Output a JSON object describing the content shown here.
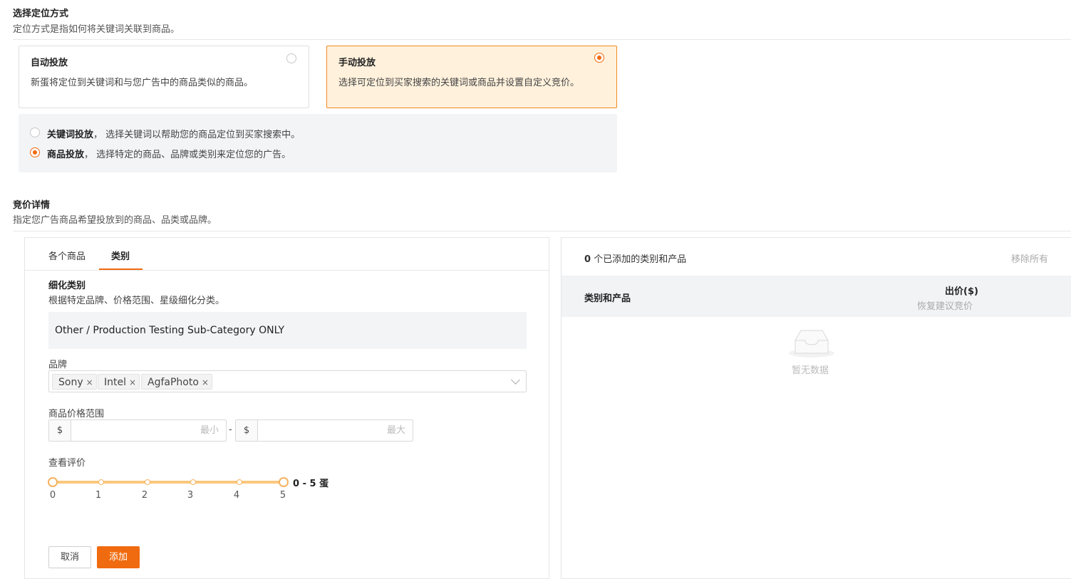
{
  "targeting": {
    "title": "选择定位方式",
    "desc": "定位方式是指如何将关键词关联到商品。",
    "auto": {
      "title": "自动投放",
      "desc": "新蛋将定位到关键词和与您广告中的商品类似的商品。",
      "selected": false
    },
    "manual": {
      "title": "手动投放",
      "desc": "选择可定位到买家搜索的关键词或商品并设置自定义竞价。",
      "selected": true
    },
    "options": [
      {
        "label": "关键词投放",
        "sep": "，",
        "desc": "选择关键词以帮助您的商品定位到买家搜索中。",
        "selected": false
      },
      {
        "label": "商品投放",
        "sep": "，",
        "desc": "选择特定的商品、品牌或类别来定位您的广告。",
        "selected": true
      }
    ]
  },
  "bidding": {
    "title": "竞价详情",
    "desc": "指定您广告商品希望投放到的商品、品类或品牌。"
  },
  "tabs": [
    {
      "label": "各个商品",
      "active": false
    },
    {
      "label": "类别",
      "active": true
    }
  ],
  "refine": {
    "title": "细化类别",
    "desc": "根据特定品牌、价格范围、星级细化分类。",
    "category": "Other / Production Testing Sub-Category ONLY",
    "brand_label": "品牌",
    "brands": [
      "Sony",
      "Intel",
      "AgfaPhoto"
    ],
    "remove_symbol": "×",
    "price_label": "商品价格范围",
    "currency": "$",
    "price_sep": "-",
    "min_placeholder": "最小",
    "max_placeholder": "最大",
    "rating_label": "查看评价",
    "rating_ticks": [
      "0",
      "1",
      "2",
      "3",
      "4",
      "5"
    ],
    "rating_min": 0,
    "rating_max": 5,
    "rating_text": "0 - 5 蛋",
    "cancel": "取消",
    "add": "添加"
  },
  "added": {
    "count": "0",
    "count_text": "个已添加的类别和产品",
    "remove_all": "移除所有",
    "col_category": "类别和产品",
    "col_bid": "出价($)",
    "col_bid_sub": "恢复建议竞价",
    "empty": "暂无数据"
  },
  "colors": {
    "accent": "#f06a0f",
    "selected_bg": "#fff1dc",
    "slider": "#fbc77d"
  },
  "icons": {
    "empty": "empty-inbox-icon",
    "chevron": "chevron-down-icon",
    "radio": "radio-icon"
  }
}
